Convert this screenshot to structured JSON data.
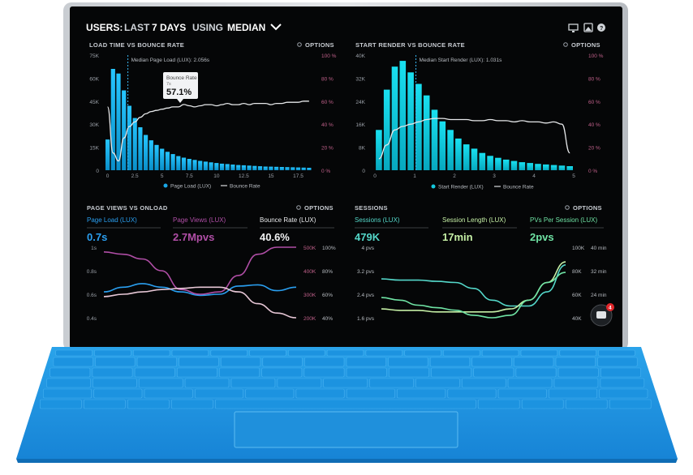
{
  "dashboard": {
    "title_users": "USERS:",
    "title_last": "LAST",
    "title_days": "7 DAYS",
    "title_using": "USING",
    "title_median": "MEDIAN",
    "icons": [
      "monitor-icon",
      "image-icon",
      "help-icon"
    ]
  },
  "panels": {
    "load_time": {
      "header": "LOAD TIME VS BOUNCE RATE",
      "options": "OPTIONS",
      "median_label": "Median Page Load (LUX): 2.056s",
      "tooltip_title": "Bounce Rate",
      "tooltip_sub": "7s",
      "tooltip_value": "57.1%",
      "legend_bar": "Page Load (LUX)",
      "legend_line": "Bounce Rate",
      "y_left": [
        "75K",
        "60K",
        "45K",
        "30K",
        "15K",
        "0"
      ],
      "y_right": [
        "100 %",
        "80 %",
        "60 %",
        "40 %",
        "20 %",
        "0 %"
      ],
      "x_ticks": [
        "0",
        "2.5",
        "5",
        "7.5",
        "10",
        "12.5",
        "15",
        "17.5"
      ]
    },
    "start_render": {
      "header": "START RENDER VS BOUNCE RATE",
      "options": "OPTIONS",
      "median_label": "Median Start Render (LUX): 1.031s",
      "legend_bar": "Start Render (LUX)",
      "legend_line": "Bounce Rate",
      "y_left": [
        "40K",
        "32K",
        "24K",
        "16K",
        "8K",
        "0"
      ],
      "y_right": [
        "100 %",
        "80 %",
        "60 %",
        "40 %",
        "20 %",
        "0 %"
      ],
      "x_ticks": [
        "0",
        "1",
        "2",
        "3",
        "4",
        "5"
      ]
    },
    "page_views": {
      "header": "PAGE VIEWS VS ONLOAD",
      "options": "OPTIONS",
      "stats": [
        {
          "label": "Page Load (LUX)",
          "value": "0.7s"
        },
        {
          "label": "Page Views (LUX)",
          "value": "2.7Mpvs"
        },
        {
          "label": "Bounce Rate (LUX)",
          "value": "40.6%"
        }
      ],
      "y_left": [
        "1s",
        "0.8s",
        "0.6s",
        "0.4s"
      ],
      "y_mid": [
        "500K",
        "400K",
        "300K",
        "200K"
      ],
      "y_right": [
        "100%",
        "80%",
        "60%",
        "40%"
      ]
    },
    "sessions": {
      "header": "SESSIONS",
      "options": "OPTIONS",
      "stats": [
        {
          "label": "Sessions (LUX)",
          "value": "479K"
        },
        {
          "label": "Session Length (LUX)",
          "value": "17min"
        },
        {
          "label": "PVs Per Session (LUX)",
          "value": "2pvs"
        }
      ],
      "y_left": [
        "4 pvs",
        "3.2 pvs",
        "2.4 pvs",
        "1.6 pvs"
      ],
      "y_mid": [
        "100K",
        "80K",
        "60K",
        "40K"
      ],
      "y_right": [
        "40 min",
        "32 min",
        "24 min",
        "16 min"
      ],
      "chat_badge": "4"
    }
  },
  "chart_data": [
    {
      "type": "bar",
      "title": "LOAD TIME VS BOUNCE RATE",
      "xlabel": "",
      "ylim": [
        0,
        75000
      ],
      "ylim_right": [
        0,
        100
      ],
      "x": [
        0,
        0.5,
        1,
        1.5,
        2,
        2.5,
        3,
        3.5,
        4,
        4.5,
        5,
        5.5,
        6,
        6.5,
        7,
        7.5,
        8,
        8.5,
        9,
        9.5,
        10,
        10.5,
        11,
        11.5,
        12,
        12.5,
        13,
        13.5,
        14,
        14.5,
        15,
        15.5,
        16,
        16.5,
        17,
        17.5,
        18,
        18.5
      ],
      "series": [
        {
          "name": "Page Load (LUX)",
          "values": [
            20000,
            66000,
            63000,
            52000,
            42000,
            34000,
            28000,
            23000,
            19500,
            16500,
            14000,
            12000,
            10500,
            9200,
            8200,
            7400,
            6700,
            6100,
            5600,
            5100,
            4700,
            4300,
            4000,
            3700,
            3400,
            3200,
            3000,
            2800,
            2600,
            2400,
            2300,
            2200,
            2100,
            2000,
            1900,
            1800,
            1700,
            1600
          ]
        },
        {
          "name": "Bounce Rate",
          "values": [
            55,
            15,
            8,
            28,
            38,
            42,
            46,
            49,
            51,
            52,
            53,
            54,
            55,
            55,
            57.1,
            56,
            55,
            56,
            57,
            57,
            56,
            57,
            58,
            57,
            57,
            58,
            57,
            58,
            58,
            58,
            57,
            58,
            58,
            59,
            59,
            59,
            60,
            60
          ]
        }
      ],
      "median": 2.056
    },
    {
      "type": "bar",
      "title": "START RENDER VS BOUNCE RATE",
      "xlabel": "",
      "ylim": [
        0,
        40000
      ],
      "ylim_right": [
        0,
        100
      ],
      "x": [
        0.1,
        0.3,
        0.5,
        0.7,
        0.9,
        1.1,
        1.3,
        1.5,
        1.7,
        1.9,
        2.1,
        2.3,
        2.5,
        2.7,
        2.9,
        3.1,
        3.3,
        3.5,
        3.7,
        3.9,
        4.1,
        4.3,
        4.5,
        4.7,
        4.9
      ],
      "series": [
        {
          "name": "Start Render (LUX)",
          "values": [
            14000,
            28000,
            36000,
            38000,
            34000,
            30000,
            26000,
            21000,
            17000,
            14000,
            11000,
            9000,
            7500,
            6000,
            5000,
            4300,
            3700,
            3200,
            2800,
            2500,
            2200,
            2000,
            1800,
            1600,
            1400
          ]
        },
        {
          "name": "Bounce Rate",
          "values": [
            10,
            22,
            35,
            38,
            40,
            42,
            44,
            45,
            45,
            44,
            44,
            44,
            43,
            43,
            44,
            43,
            43,
            42,
            43,
            42,
            42,
            41,
            42,
            40,
            15
          ]
        }
      ],
      "median": 1.031
    },
    {
      "type": "line",
      "title": "PAGE VIEWS VS ONLOAD",
      "x": [
        0,
        1,
        2,
        3,
        4,
        5,
        6,
        7,
        8,
        9,
        10
      ],
      "series": [
        {
          "name": "Page Load (LUX)",
          "values": [
            0.62,
            0.66,
            0.69,
            0.66,
            0.62,
            0.59,
            0.6,
            0.67,
            0.68,
            0.63,
            0.66
          ]
        },
        {
          "name": "Page Views (LUX)",
          "values": [
            480000,
            470000,
            450000,
            400000,
            320000,
            300000,
            310000,
            380000,
            470000,
            500000,
            500000
          ]
        },
        {
          "name": "Bounce Rate (LUX)",
          "values": [
            58,
            60,
            62,
            64,
            65,
            66,
            66,
            62,
            52,
            44,
            40
          ]
        }
      ]
    },
    {
      "type": "line",
      "title": "SESSIONS",
      "x": [
        0,
        1,
        2,
        3,
        4,
        5,
        6,
        7,
        8,
        9,
        10
      ],
      "series": [
        {
          "name": "Sessions (LUX)",
          "values": [
            73000,
            72000,
            72000,
            71000,
            70000,
            65000,
            55000,
            50000,
            50000,
            62000,
            85000
          ]
        },
        {
          "name": "Session Length (LUX)",
          "values": [
            19,
            18.5,
            18.5,
            18,
            18,
            18,
            18,
            19,
            22,
            28,
            35
          ]
        },
        {
          "name": "PVs Per Session (LUX)",
          "values": [
            2.0,
            1.9,
            1.7,
            1.6,
            1.5,
            1.3,
            1.2,
            1.3,
            1.9,
            2.6,
            3.0
          ]
        }
      ]
    }
  ]
}
